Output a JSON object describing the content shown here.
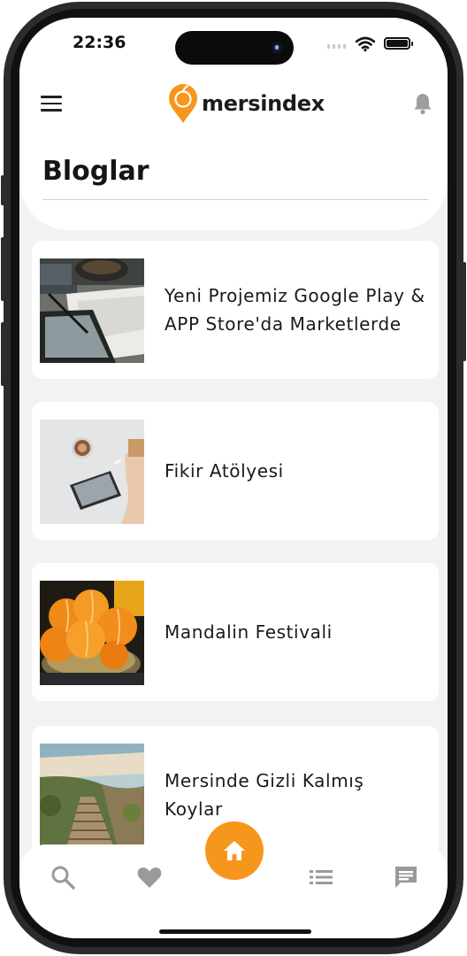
{
  "status_bar": {
    "time": "22:36"
  },
  "header": {
    "brand": "mersindex",
    "title": "Bloglar"
  },
  "blogs": [
    {
      "title": "Yeni Projemiz Google Play & APP Store'da Marketlerde",
      "thumb_icon": "notebook-tablet-photo"
    },
    {
      "title": "Fikir Atölyesi",
      "thumb_icon": "coffee-phone-desk-photo"
    },
    {
      "title": "Mandalin Festivali",
      "thumb_icon": "tangerines-bowl-photo"
    },
    {
      "title": "Mersinde Gizli Kalmış Koylar",
      "thumb_icon": "coastal-stairs-photo"
    }
  ],
  "bottom_nav": {
    "items": [
      "search-icon",
      "heart-icon",
      "home-icon",
      "list-icon",
      "chat-icon"
    ],
    "active": "home-icon"
  },
  "colors": {
    "accent": "#f7961d",
    "background": "#f2f2f2",
    "card": "#ffffff"
  }
}
